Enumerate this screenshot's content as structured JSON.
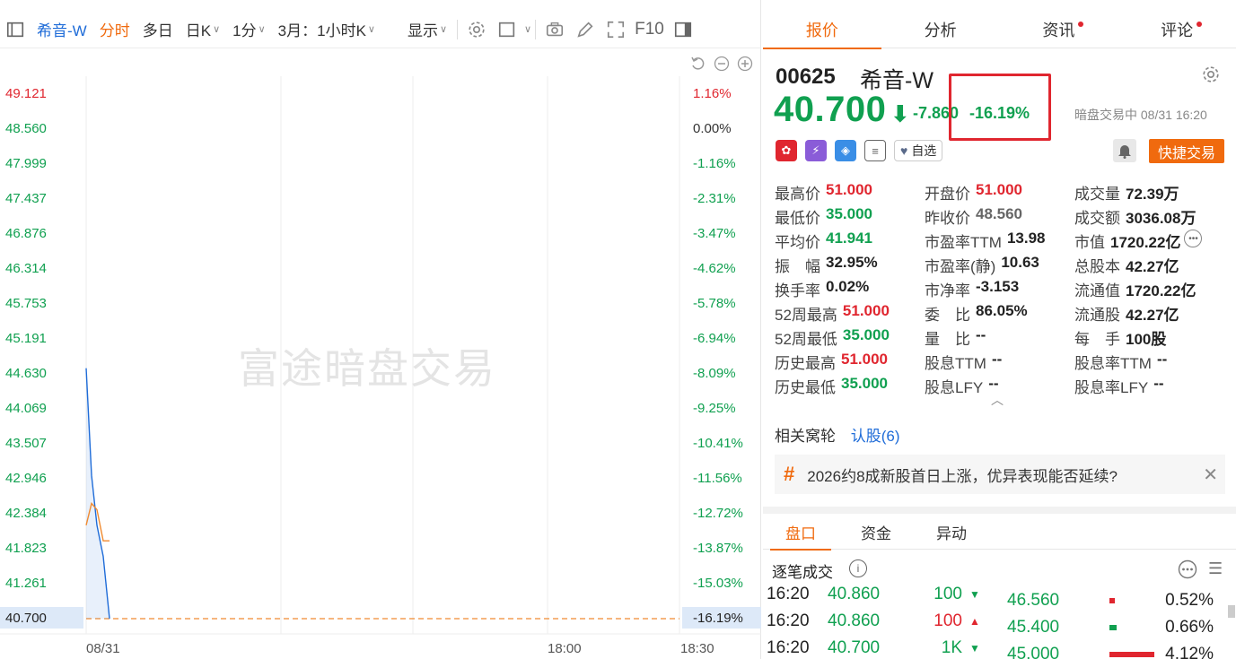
{
  "toolbar": {
    "stock_name": "希音-W",
    "tabs": [
      "分时",
      "多日",
      "日K",
      "1分",
      "3月：1小时K",
      "显示"
    ],
    "f10_label": "F10"
  },
  "chart": {
    "watermark": "富途暗盘交易",
    "price_ticks": [
      "49.121",
      "48.560",
      "47.999",
      "47.437",
      "46.876",
      "46.314",
      "45.753",
      "45.191",
      "44.630",
      "44.069",
      "43.507",
      "42.946",
      "42.384",
      "41.823",
      "41.261",
      "40.700"
    ],
    "pct_ticks": [
      "1.16%",
      "0.00%",
      "-1.16%",
      "-2.31%",
      "-3.47%",
      "-4.62%",
      "-5.78%",
      "-6.94%",
      "-8.09%",
      "-9.25%",
      "-10.41%",
      "-11.56%",
      "-12.72%",
      "-13.87%",
      "-15.03%",
      "-16.19%"
    ],
    "time_ticks": [
      "08/31",
      "18:00",
      "18:30"
    ]
  },
  "chart_data": {
    "type": "line",
    "y_range": [
      40.7,
      49.121
    ],
    "series": [
      {
        "color": "#1f6cd8",
        "values": [
          44.72,
          43.0,
          42.2,
          41.7,
          40.7
        ]
      },
      {
        "color": "#f08a30",
        "values": [
          42.2,
          42.55,
          42.45,
          41.95,
          41.95
        ]
      }
    ]
  },
  "right_tabs": [
    {
      "label": "报价",
      "dot": false
    },
    {
      "label": "分析",
      "dot": false
    },
    {
      "label": "资讯",
      "dot": true
    },
    {
      "label": "评论",
      "dot": true
    }
  ],
  "quote": {
    "code": "00625",
    "name": "希音-W",
    "price": "40.700",
    "change": "-7.860",
    "change_pct": "-16.19%",
    "status": "暗盘交易中 08/31 16:20",
    "fav_label": "自选",
    "quick_trade_label": "快捷交易"
  },
  "stats": [
    [
      {
        "k": "最高价",
        "v": "51.000",
        "c": "up"
      },
      {
        "k": "开盘价",
        "v": "51.000",
        "c": "up"
      },
      {
        "k": "成交量",
        "v": "72.39万",
        "c": ""
      }
    ],
    [
      {
        "k": "最低价",
        "v": "35.000",
        "c": "down"
      },
      {
        "k": "昨收价",
        "v": "48.560",
        "c": "gray"
      },
      {
        "k": "成交额",
        "v": "3036.08万",
        "c": ""
      }
    ],
    [
      {
        "k": "平均价",
        "v": "41.941",
        "c": "down"
      },
      {
        "k": "市盈率TTM",
        "v": "13.98",
        "c": ""
      },
      {
        "k": "市值",
        "v": "1720.22亿",
        "c": ""
      }
    ],
    [
      {
        "k": "振　幅",
        "v": "32.95%",
        "c": ""
      },
      {
        "k": "市盈率(静)",
        "v": "10.63",
        "c": ""
      },
      {
        "k": "总股本",
        "v": "42.27亿",
        "c": ""
      }
    ],
    [
      {
        "k": "换手率",
        "v": "0.02%",
        "c": ""
      },
      {
        "k": "市净率",
        "v": "-3.153",
        "c": ""
      },
      {
        "k": "流通值",
        "v": "1720.22亿",
        "c": ""
      }
    ],
    [
      {
        "k": "52周最高",
        "v": "51.000",
        "c": "up"
      },
      {
        "k": "委　比",
        "v": "86.05%",
        "c": ""
      },
      {
        "k": "流通股",
        "v": "42.27亿",
        "c": ""
      }
    ],
    [
      {
        "k": "52周最低",
        "v": "35.000",
        "c": "down"
      },
      {
        "k": "量　比",
        "v": "--",
        "c": ""
      },
      {
        "k": "每　手",
        "v": "100股",
        "c": ""
      }
    ],
    [
      {
        "k": "历史最高",
        "v": "51.000",
        "c": "up"
      },
      {
        "k": "股息TTM",
        "v": "--",
        "c": ""
      },
      {
        "k": "股息率TTM",
        "v": "--",
        "c": ""
      }
    ],
    [
      {
        "k": "历史最低",
        "v": "35.000",
        "c": "down"
      },
      {
        "k": "股息LFY",
        "v": "--",
        "c": ""
      },
      {
        "k": "股息率LFY",
        "v": "--",
        "c": ""
      }
    ]
  ],
  "related": {
    "label": "相关窝轮",
    "link": "认股(6)"
  },
  "news": {
    "text": "2026约8成新股首日上涨，优异表现能否延续?"
  },
  "sub_tabs": [
    "盘口",
    "资金",
    "异动"
  ],
  "trades_title": "逐笔成交",
  "trades": [
    {
      "time": "16:20",
      "price": "40.860",
      "qty": "100",
      "dir": "down"
    },
    {
      "time": "16:20",
      "price": "40.860",
      "qty": "100",
      "dir": "up"
    },
    {
      "time": "16:20",
      "price": "40.700",
      "qty": "1K",
      "dir": "down"
    }
  ],
  "levels": [
    {
      "price": "46.560",
      "pct": "0.52%",
      "pct_value": 0.52,
      "bar_color": "#e0262f"
    },
    {
      "price": "45.400",
      "pct": "0.66%",
      "pct_value": 0.66,
      "bar_color": "#10a050"
    },
    {
      "price": "45.000",
      "pct": "4.12%",
      "pct_value": 4.12,
      "bar_color": "#e0262f"
    }
  ]
}
